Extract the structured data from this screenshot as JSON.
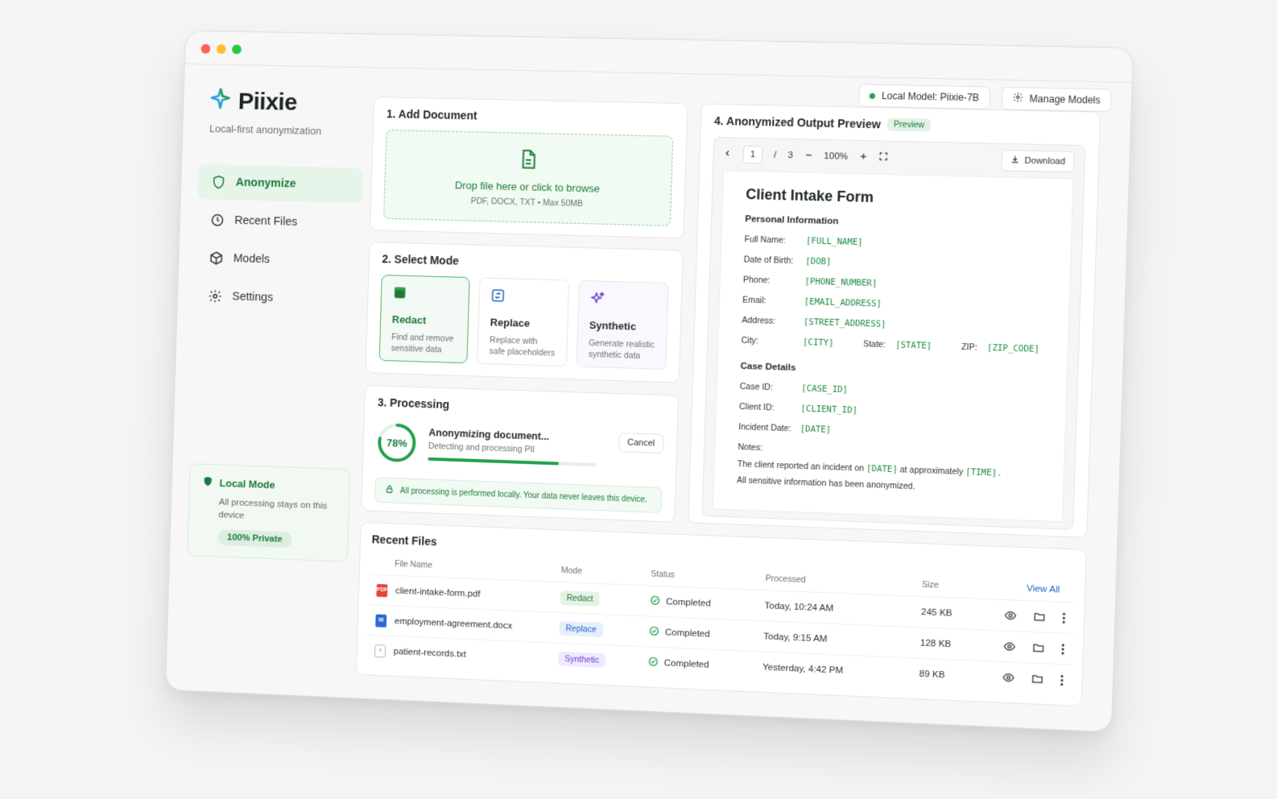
{
  "header": {
    "model_status": "Local Model: Piixie-7B",
    "manage_models": "Manage Models"
  },
  "brand": {
    "name": "Piixie",
    "tagline": "Local-first anonymization"
  },
  "sidebar": {
    "items": [
      {
        "label": "Anonymize",
        "icon": "shield-icon",
        "active": true
      },
      {
        "label": "Recent Files",
        "icon": "clock-icon"
      },
      {
        "label": "Models",
        "icon": "cube-icon"
      },
      {
        "label": "Settings",
        "icon": "gear-icon"
      }
    ],
    "local_mode": {
      "title": "Local Mode",
      "text": "All processing stays on this device",
      "badge": "100% Private"
    }
  },
  "add_document": {
    "title": "1. Add Document",
    "drop_text": "Drop file here or click to browse",
    "formats": "PDF, DOCX, TXT • Max 50MB"
  },
  "select_mode": {
    "title": "2. Select Mode",
    "modes": [
      {
        "name": "Redact",
        "desc": "Find and remove sensitive data"
      },
      {
        "name": "Replace",
        "desc": "Replace with safe placeholders"
      },
      {
        "name": "Synthetic",
        "desc": "Generate realistic synthetic data"
      }
    ]
  },
  "processing": {
    "title": "3. Processing",
    "percent_label": "78%",
    "progress": 0.78,
    "status": "Anonymizing document...",
    "substatus": "Detecting and processing PII",
    "cancel": "Cancel",
    "note": "All processing is performed locally. Your data never leaves this device."
  },
  "preview": {
    "title": "4. Anonymized Output Preview",
    "badge": "Preview",
    "page": "1",
    "page_sep": "/",
    "page_total": "3",
    "zoom": "100%",
    "download": "Download",
    "doc": {
      "title": "Client Intake Form",
      "section1": "Personal Information",
      "full_name_label": "Full Name:",
      "full_name": "[FULL_NAME]",
      "dob_label": "Date of Birth:",
      "dob": "[DOB]",
      "phone_label": "Phone:",
      "phone": "[PHONE_NUMBER]",
      "email_label": "Email:",
      "email": "[EMAIL_ADDRESS]",
      "address_label": "Address:",
      "address": "[STREET_ADDRESS]",
      "city_label": "City:",
      "city": "[CITY]",
      "state_label": "State:",
      "state": "[STATE]",
      "zip_label": "ZIP:",
      "zip": "[ZIP_CODE]",
      "section2": "Case Details",
      "case_label": "Case ID:",
      "case": "[CASE_ID]",
      "client_label": "Client ID:",
      "client": "[CLIENT_ID]",
      "incident_label": "Incident Date:",
      "incident": "[DATE]",
      "notes_label": "Notes:",
      "notes_pre": "The client reported an incident on",
      "notes_date": "[DATE]",
      "notes_mid": "at approximately",
      "notes_time": "[TIME].",
      "notes_end": "All sensitive information has been anonymized."
    }
  },
  "recent": {
    "title": "Recent Files",
    "view_all": "View All",
    "columns": [
      "File Name",
      "Mode",
      "Status",
      "Processed",
      "Size"
    ],
    "rows": [
      {
        "name": "client-intake-form.pdf",
        "type": "pdf",
        "mode": "Redact",
        "status": "Completed",
        "processed": "Today, 10:24 AM",
        "size": "245 KB"
      },
      {
        "name": "employment-agreement.docx",
        "type": "doc",
        "mode": "Replace",
        "status": "Completed",
        "processed": "Today, 9:15 AM",
        "size": "128 KB"
      },
      {
        "name": "patient-records.txt",
        "type": "txt",
        "mode": "Synthetic",
        "status": "Completed",
        "processed": "Yesterday, 4:42 PM",
        "size": "89 KB"
      }
    ]
  },
  "colors": {
    "accent": "#1d7a3a",
    "accent_light": "#e6f4e9",
    "replace_blue": "#2463c4",
    "synthetic_purple": "#6a3fcf"
  }
}
